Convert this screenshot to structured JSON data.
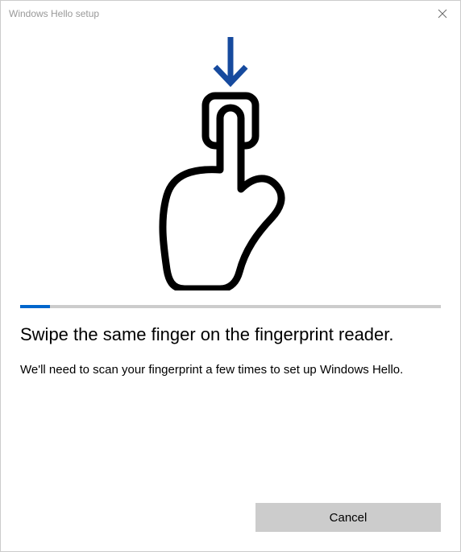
{
  "window": {
    "title": "Windows Hello setup"
  },
  "main": {
    "heading": "Swipe the same finger on the fingerprint reader.",
    "subtext": "We'll need to scan your fingerprint a few times to set up Windows Hello."
  },
  "progress": {
    "percent": 7
  },
  "buttons": {
    "cancel": "Cancel"
  },
  "colors": {
    "accent": "#0066cc",
    "arrow": "#164a9e"
  },
  "icons": {
    "close": "close-icon",
    "illustration": "fingerprint-touch-icon",
    "arrow": "arrow-down-icon"
  }
}
